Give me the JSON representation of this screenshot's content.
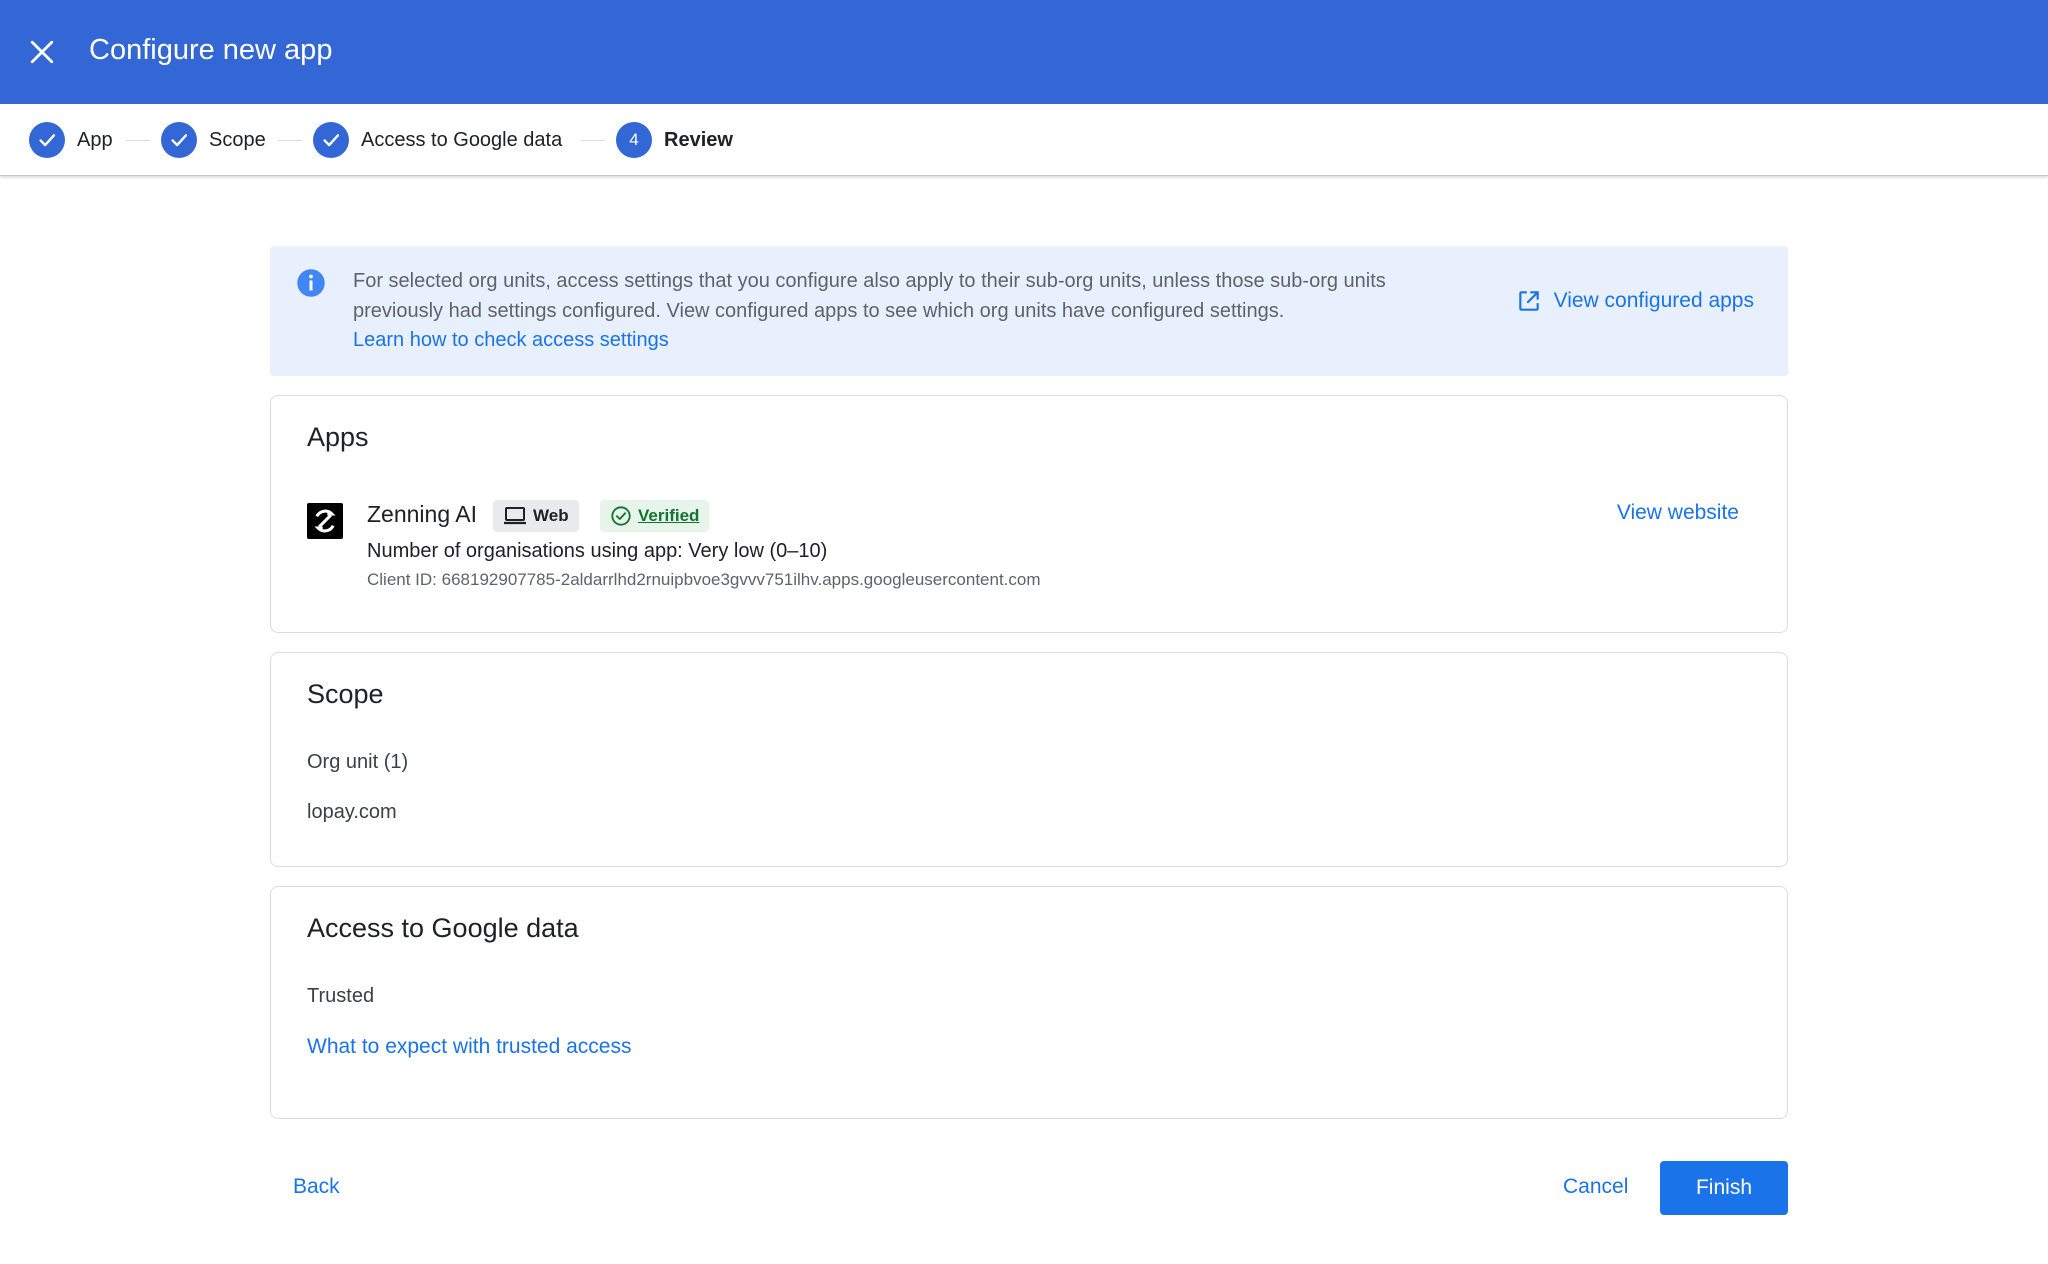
{
  "header": {
    "title": "Configure new app",
    "close_icon": "close-icon"
  },
  "stepper": {
    "steps": [
      {
        "label": "App",
        "state": "done"
      },
      {
        "label": "Scope",
        "state": "done"
      },
      {
        "label": "Access to Google data",
        "state": "done"
      },
      {
        "label": "Review",
        "state": "active",
        "number": "4"
      }
    ]
  },
  "info_banner": {
    "text": "For selected org units, access settings that you configure also apply to their sub-org units, unless those sub-org units previously had settings configured. View configured apps to see which org units have configured settings.",
    "link": "Learn how to check access settings",
    "action": "View configured apps"
  },
  "apps_card": {
    "title": "Apps",
    "app_name": "Zenning AI",
    "platform_chip": "Web",
    "verified_chip": "Verified",
    "orgs_using": "Number of organisations using app: Very low (0–10)",
    "client_id": "Client ID: 668192907785-2aldarrlhd2rnuipbvoe3gvvv751ilhv.apps.googleusercontent.com",
    "view_website": "View website"
  },
  "scope_card": {
    "title": "Scope",
    "org_unit_label": "Org unit (1)",
    "org_unit_value": "lopay.com"
  },
  "access_card": {
    "title": "Access to Google data",
    "value": "Trusted",
    "link": "What to expect with trusted access"
  },
  "footer": {
    "back": "Back",
    "cancel": "Cancel",
    "finish": "Finish"
  },
  "colors": {
    "primary": "#3367d6",
    "link": "#1a73e8",
    "banner_bg": "#e8f0fe",
    "verified_bg": "#e6f4ea",
    "verified_text": "#137333"
  }
}
